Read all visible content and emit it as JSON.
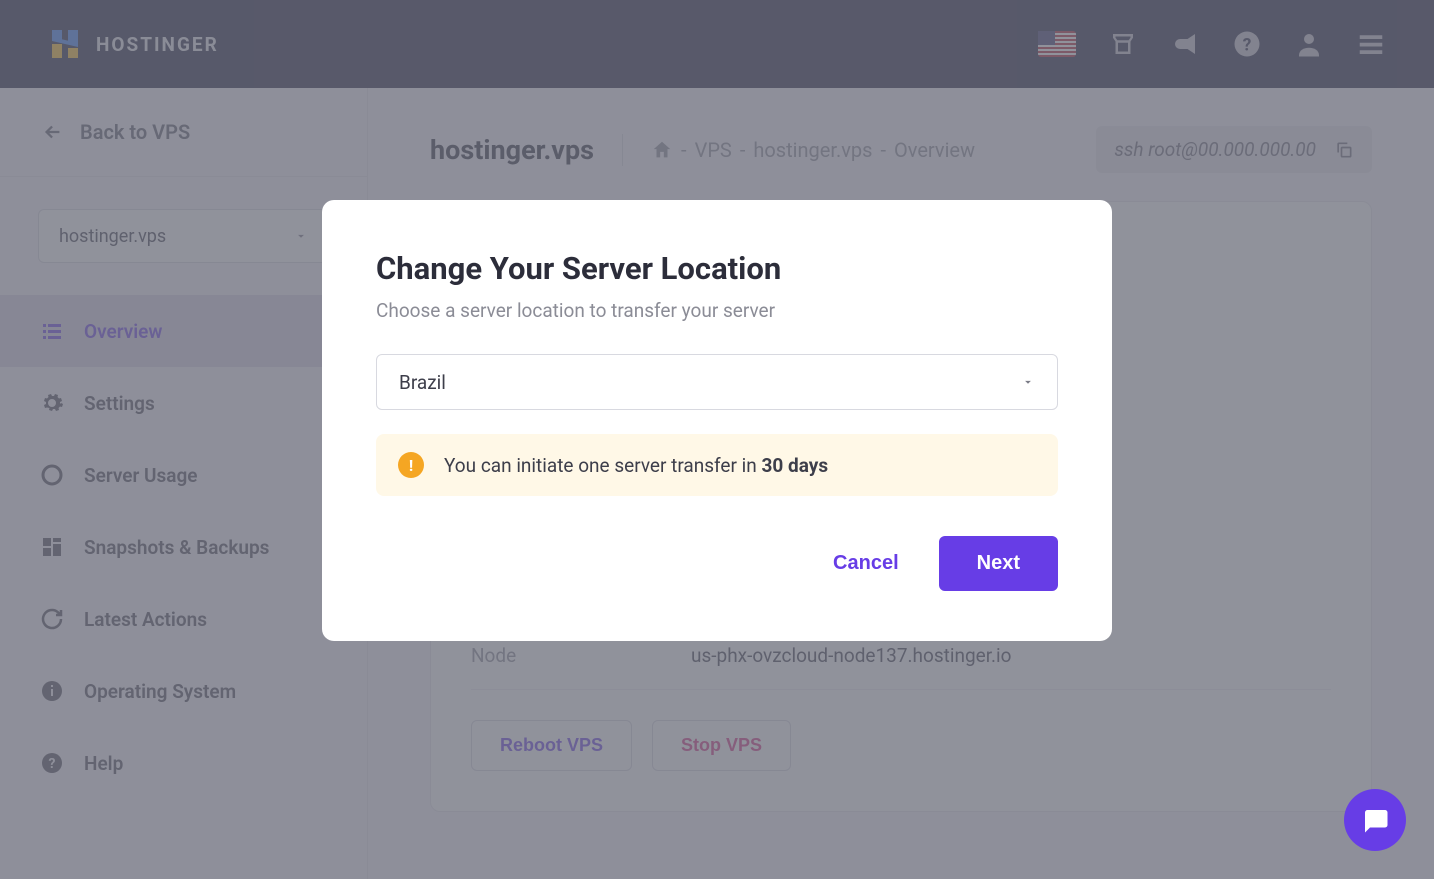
{
  "header": {
    "brand": "HOSTINGER"
  },
  "sidebar": {
    "back": "Back to VPS",
    "selected": "hostinger.vps",
    "items": [
      {
        "label": "Overview"
      },
      {
        "label": "Settings"
      },
      {
        "label": "Server Usage"
      },
      {
        "label": "Snapshots & Backups"
      },
      {
        "label": "Latest Actions"
      },
      {
        "label": "Operating System"
      },
      {
        "label": "Help"
      }
    ]
  },
  "content": {
    "server_name": "hostinger.vps",
    "breadcrumb_sep": "-",
    "breadcrumb_vps": "VPS",
    "breadcrumb_host": "hostinger.vps",
    "breadcrumb_page": "Overview",
    "ssh": "ssh root@00.000.000.00",
    "node_label": "Node",
    "node_value": "us-phx-ovzcloud-node137.hostinger.io",
    "reboot": "Reboot VPS",
    "stop": "Stop VPS"
  },
  "modal": {
    "title": "Change Your Server Location",
    "subtitle": "Choose a server location to transfer your server",
    "selected_location": "Brazil",
    "alert_prefix": "You can initiate one server transfer in ",
    "alert_strong": "30 days",
    "cancel": "Cancel",
    "next": "Next"
  }
}
